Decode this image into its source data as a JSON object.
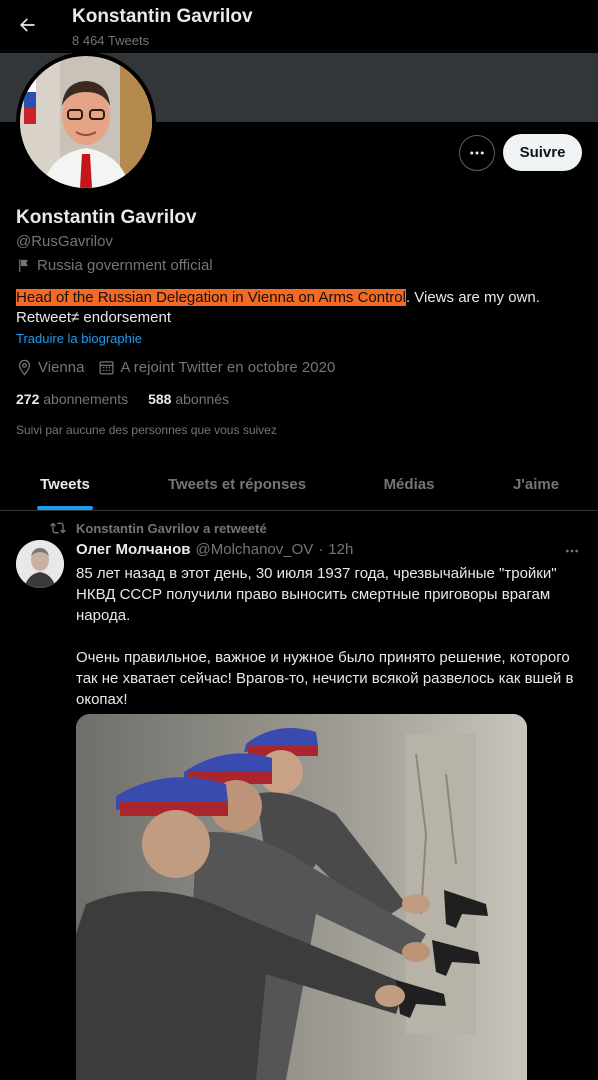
{
  "topbar": {
    "title": "Konstantin Gavrilov",
    "tweet_count": "8 464 Tweets",
    "back_icon": "arrow-left-icon"
  },
  "profile": {
    "name": "Konstantin Gavrilov",
    "handle": "@RusGavrilov",
    "label": "Russia government official",
    "bio_highlight": "Head of the Russian Delegation in Vienna on Arms Control",
    "bio_rest": ". Views are my own.",
    "bio_line2": "Retweet≠ endorsement",
    "translate": "Traduire la biographie",
    "location": "Vienna",
    "joined": "A rejoint Twitter en octobre 2020",
    "following_count": "272",
    "following_label": "abonnements",
    "followers_count": "588",
    "followers_label": "abonnés",
    "followed_by": "Suivi par aucune des personnes que vous suivez",
    "follow_button": "Suivre",
    "highlight_color": "#f26a24"
  },
  "tabs": [
    {
      "label": "Tweets",
      "active": true
    },
    {
      "label": "Tweets et réponses",
      "active": false
    },
    {
      "label": "Médias",
      "active": false
    },
    {
      "label": "J'aime",
      "active": false
    }
  ],
  "tweet": {
    "retweet_label": "Konstantin Gavrilov a retweeté",
    "author": "Олег Молчанов",
    "handle": "@Molchanov_OV",
    "time": "12h",
    "text_p1": "85 лет назад в этот день, 30 июля 1937 года, чрезвычайные \"тройки\" НКВД СССР получили право выносить смертные приговоры врагам народа.",
    "text_p2": "Очень правильное, важное и нужное было принято решение, которого так не хватает сейчас! Врагов-то, нечисти всякой развелось как вшей в окопах!"
  },
  "colors": {
    "accent": "#1d9bf0",
    "background": "#000000",
    "secondary_text": "#71767b"
  }
}
